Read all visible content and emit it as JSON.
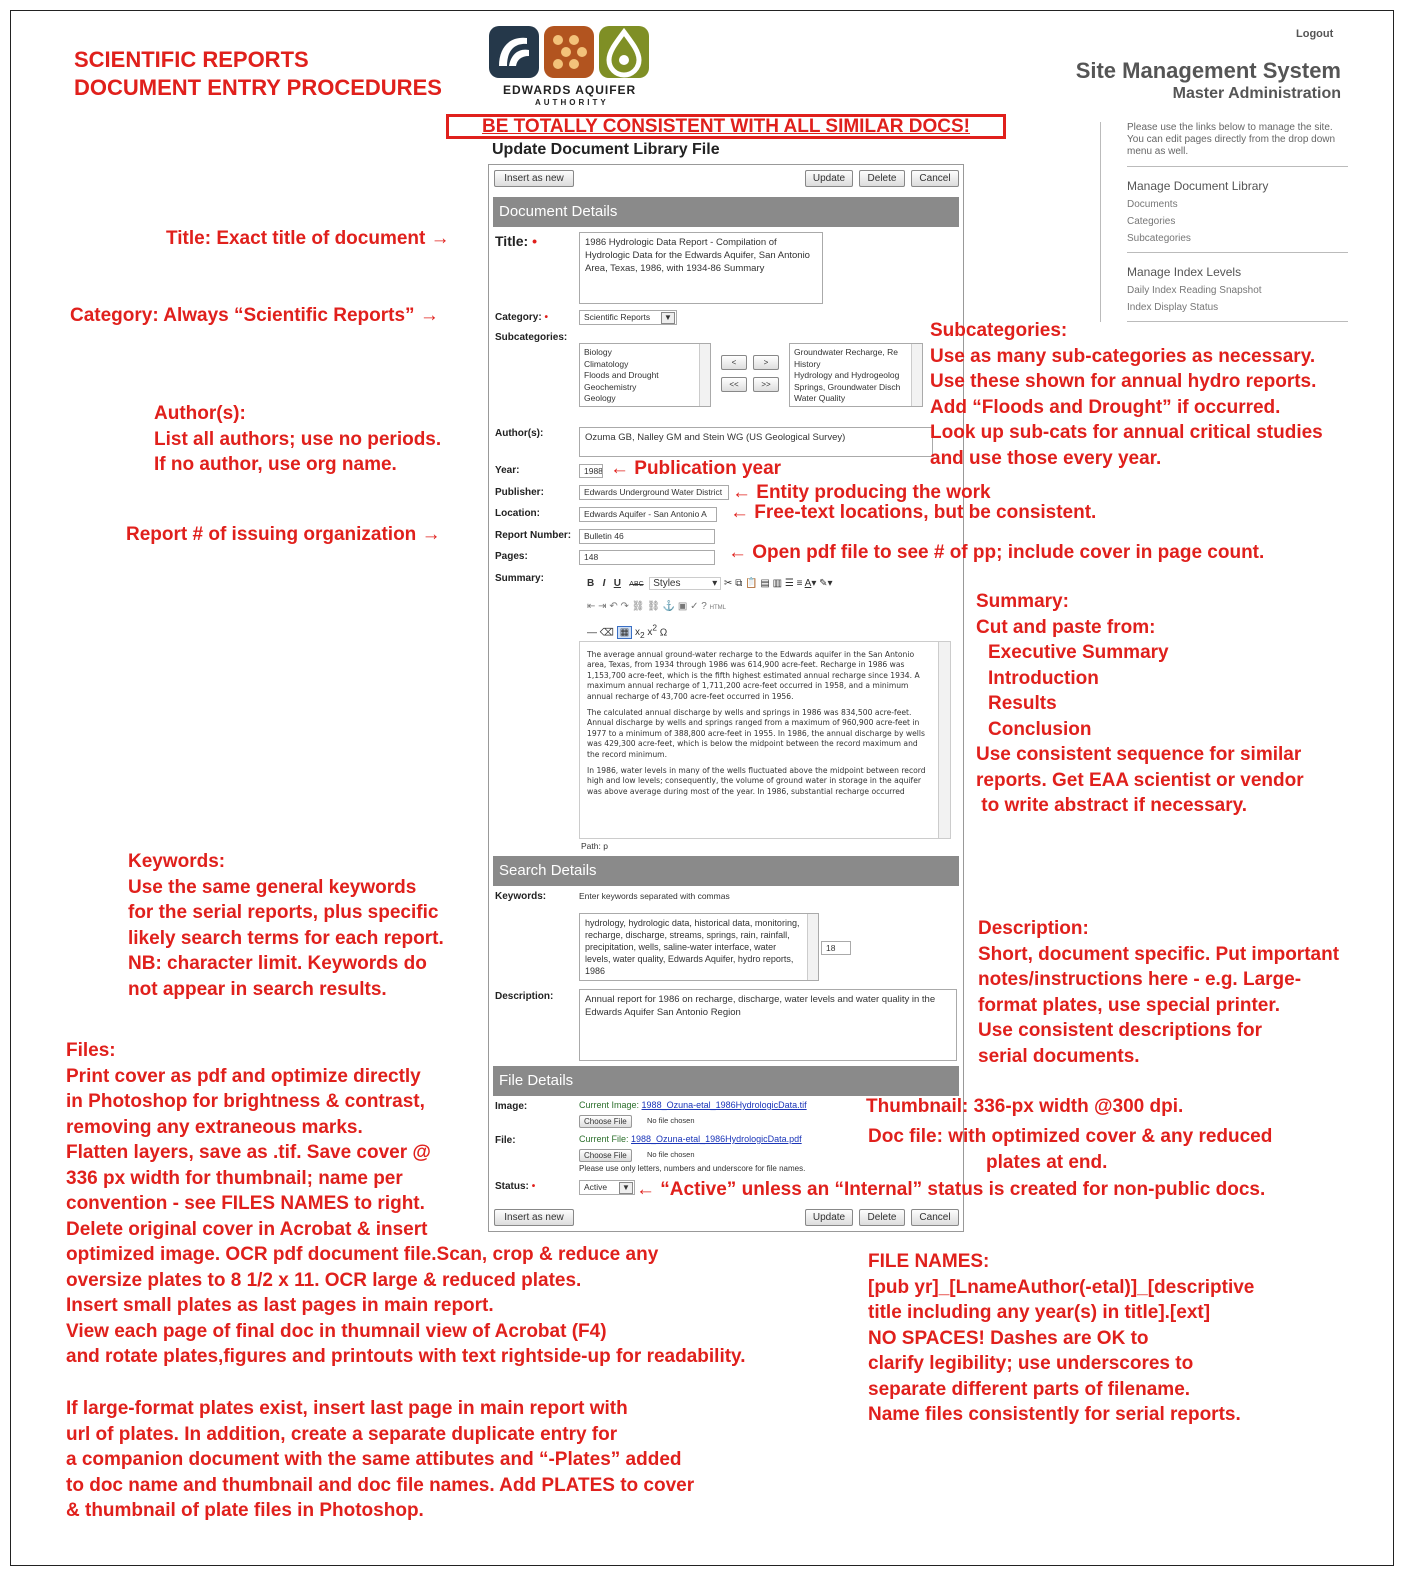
{
  "header": {
    "title_lines": [
      "SCIENTIFIC REPORTS",
      "DOCUMENT ENTRY PROCEDURES"
    ],
    "logo_name": "EDWARDS AQUIFER",
    "logo_sub": "AUTHORITY",
    "banner": "BE TOTALLY CONSISTENT WITH ALL SIMILAR DOCS!"
  },
  "sms": {
    "logout": "Logout",
    "title": "Site Management System",
    "subtitle": "Master Administration",
    "help": "Please use the links below to manage the site. You can edit pages directly from the drop down menu as well.",
    "group1": "Manage Document Library",
    "group1_links": [
      "Documents",
      "Categories",
      "Subcategories"
    ],
    "group2": "Manage Index Levels",
    "group2_links": [
      "Daily Index Reading Snapshot",
      "Index Display Status"
    ]
  },
  "form": {
    "title": "Update Document Library File",
    "insert_as_new": "Insert as new",
    "update": "Update",
    "delete": "Delete",
    "cancel": "Cancel",
    "document_details": "Document Details",
    "title_label": "Title:",
    "title_value": "1986 Hydrologic Data Report - Compilation of Hydrologic Data for the Edwards Aquifer, San Antonio Area, Texas, 1986, with 1934-86 Summary",
    "category_label": "Category:",
    "category_value": "Scientific Reports",
    "subcategories_label": "Subcategories:",
    "sub_available": [
      "Biology",
      "Climatology",
      "Floods and Drought",
      "Geochemistry",
      "Geology"
    ],
    "sub_selected": [
      "Groundwater Recharge, Re",
      "History",
      "Hydrology and Hydrogeolog",
      "Springs, Groundwater Disch",
      "Water Quality"
    ],
    "move_right": ">",
    "move_left": "<",
    "move_all_left": "<<",
    "move_all_right": ">>",
    "authors_label": "Author(s):",
    "authors_value": "Ozuma GB, Nalley GM and Stein WG (US Geological Survey)",
    "year_label": "Year:",
    "year_value": "1988",
    "publisher_label": "Publisher:",
    "publisher_value": "Edwards Underground Water District",
    "location_label": "Location:",
    "location_value": "Edwards Aquifer - San Antonio A",
    "report_label": "Report Number:",
    "report_value": "Bulletin 46",
    "pages_label": "Pages:",
    "pages_value": "148",
    "summary_label": "Summary:",
    "toolbar_styles": "Styles",
    "summary_paragraphs": [
      "The average annual ground-water recharge to the Edwards aquifer in the San Antonio area, Texas, from 1934 through 1986 was 614,900 acre-feet. Recharge in 1986 was 1,153,700 acre-feet, which is the fifth highest estimated annual recharge since 1934. A maximum annual recharge of 1,711,200 acre-feet occurred in 1958, and a minimum annual recharge of 43,700 acre-feet occurred in 1956.",
      "The calculated annual discharge by wells and springs in 1986 was 834,500 acre-feet. Annual discharge by wells and springs ranged from a maximum of 960,900 acre-feet in 1977 to a minimum of 388,800 acre-feet in 1955. In 1986, the annual discharge by wells was 429,300 acre-feet, which is below the midpoint between the record maximum and the record minimum.",
      "In 1986, water levels in many of the wells fluctuated above the midpoint between record high and low levels; consequently, the volume of ground water in storage in the aquifer was above average during most of the year. In 1986, substantial recharge occurred"
    ],
    "path": "Path: p",
    "search_details": "Search Details",
    "keywords_label": "Keywords:",
    "keywords_hint": "Enter keywords separated with commas",
    "keywords_value": "hydrology, hydrologic data, historical data, monitoring, recharge, discharge, streams, springs, rain, rainfall, precipitation, wells, saline-water interface, water levels, water quality, Edwards Aquifer, hydro reports, 1986",
    "keywords_count": "18",
    "description_label": "Description:",
    "description_value": "Annual report for 1986 on recharge, discharge, water levels and water quality in the Edwards Aquifer San Antonio Region",
    "file_details": "File Details",
    "image_label": "Image:",
    "current_image_label": "Current Image:",
    "current_image": "1988_Ozuna-etal_1986HydrologicData.tif",
    "choose_file": "Choose File",
    "no_file": "No file chosen",
    "file_label": "File:",
    "current_file_label": "Current File:",
    "current_file": "1988_Ozuna-etal_1986HydrologicData.pdf",
    "file_note": "Please use only letters, numbers and underscore for file names.",
    "status_label": "Status:",
    "status_value": "Active"
  },
  "annotations": {
    "title_note": "Title: Exact title of document →",
    "category_note": "Category: Always “Scientific Reports” →",
    "authors_note": [
      "Author(s):",
      "List all authors; use no periods.",
      "If no author, use org name."
    ],
    "report_note": "Report # of issuing organization →",
    "year_note": "← Publication year",
    "publisher_note": "← Entity producing the work",
    "location_note": "← Free-text locations, but be consistent.",
    "pages_note": "← Open pdf file to see # of pp; include cover in page count.",
    "subcat_note": [
      "Subcategories:",
      "Use as many sub-categories as necessary.",
      "Use these shown for annual hydro reports.",
      "Add “Floods and  Drought” if occurred.",
      "Look up sub-cats for annual critical studies",
      "and use those every year."
    ],
    "summary_note_head": [
      "Summary:",
      "Cut and paste from:"
    ],
    "summary_note_items": [
      "Executive Summary",
      "Introduction",
      "Results",
      "Conclusion"
    ],
    "summary_note_tail": [
      "Use consistent sequence for similar",
      "reports. Get EAA scientist or vendor",
      " to write abstract if necessary."
    ],
    "keywords_note": [
      "Keywords:",
      "Use the same general keywords",
      "for the serial reports, plus specific",
      "likely search terms for each report.",
      "NB: character limit.  Keywords do",
      "not appear in search results."
    ],
    "description_note": [
      "Description:",
      "Short, document specific. Put important",
      "notes/instructions here - e.g. Large-",
      "format plates, use special printer.",
      "Use consistent descriptions for",
      "serial documents."
    ],
    "thumbnail_note": "Thumbnail: 336-px width @300 dpi.",
    "docfile_note": [
      "Doc file: with optimized cover & any reduced",
      "plates at end."
    ],
    "status_note": "← “Active” unless an “Internal” status is created for non-public docs.",
    "files_note": [
      "Files:",
      "Print cover as pdf and optimize directly",
      "in Photoshop for brightness & contrast,",
      "removing any extraneous marks.",
      "Flatten layers, save as .tif.  Save cover @",
      "336 px width for thumbnail;  name per",
      "convention - see FILES NAMES to right.",
      "Delete original cover in Acrobat & insert",
      "optimized image. OCR pdf document file.Scan, crop & reduce any",
      "oversize plates to 8 1/2 x 11. OCR large & reduced plates.",
      "Insert small plates as last pages in main report.",
      "View each page of final doc in thumnail view of Acrobat (F4)",
      "and rotate plates,figures and printouts with text rightside-up for readability."
    ],
    "plates_note": [
      "If large-format plates exist, insert last page in main report with",
      "url of plates. In addition, create a separate duplicate entry for",
      "a companion document with the same attibutes and “-Plates” added",
      "to doc name and thumbnail and doc file names.  Add PLATES to cover",
      "& thumbnail of plate files in Photoshop."
    ],
    "filenames_note": [
      "FILE NAMES:",
      "[pub yr]_[LnameAuthor(-etal)]_[descriptive",
      "title including any year(s) in title].[ext]",
      "NO SPACES! Dashes are OK to",
      "clarify legibility; use underscores to",
      "separate different parts of filename.",
      "Name files consistently for serial reports."
    ]
  },
  "colors": {
    "annotation_red": "#e0201c",
    "section_gray": "#8a8a8a",
    "link_blue": "#1a35b8"
  }
}
